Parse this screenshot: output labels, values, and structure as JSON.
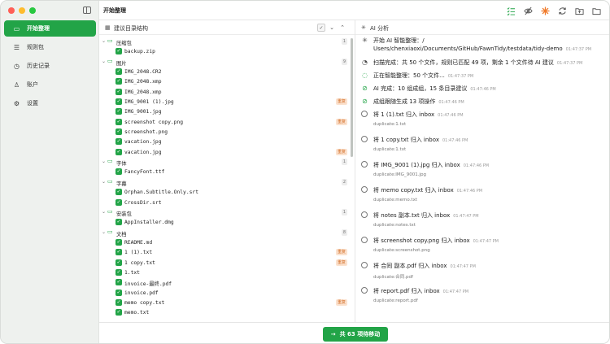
{
  "colors": {
    "accent": "#22a447",
    "tag_bg": "#fbe2cf",
    "tag_fg": "#d2691e",
    "traffic_red": "#ff5f57",
    "traffic_yellow": "#febc2e",
    "traffic_green": "#28c840"
  },
  "header": {
    "title": "开始整理"
  },
  "toolbar_icons": [
    "list-check-icon",
    "eye-off-icon",
    "sparkle-icon",
    "refresh-icon",
    "folder-export-icon",
    "folder-icon"
  ],
  "sidebar": {
    "items": [
      {
        "label": "开始整理",
        "icon": "folder-open-icon",
        "glyph": "▭",
        "active": true
      },
      {
        "label": "规则包",
        "icon": "rules-icon",
        "glyph": "☰"
      },
      {
        "label": "历史记录",
        "icon": "history-icon",
        "glyph": "◷"
      },
      {
        "label": "账户",
        "icon": "user-icon",
        "glyph": "♙"
      },
      {
        "label": "设置",
        "icon": "gear-icon",
        "glyph": "⚙"
      }
    ]
  },
  "structure": {
    "title": "建议目录结构",
    "tree": [
      {
        "type": "folder",
        "name": "压缩包",
        "count": "1"
      },
      {
        "type": "file",
        "name": "backup.zip"
      },
      {
        "type": "folder",
        "name": "图片",
        "count": "9"
      },
      {
        "type": "file",
        "name": "IMG_2048.CR2"
      },
      {
        "type": "file",
        "name": "IMG_2048.xmp"
      },
      {
        "type": "file",
        "name": "IMG_2048.xmp"
      },
      {
        "type": "file",
        "name": "IMG_9001 (1).jpg",
        "tag": "重复"
      },
      {
        "type": "file",
        "name": "IMG_9001.jpg"
      },
      {
        "type": "file",
        "name": "screenshot copy.png",
        "tag": "重复"
      },
      {
        "type": "file",
        "name": "screenshot.png"
      },
      {
        "type": "file",
        "name": "vacation.jpg"
      },
      {
        "type": "file",
        "name": "vacation.jpg",
        "tag": "重复"
      },
      {
        "type": "folder",
        "name": "字体",
        "count": "1"
      },
      {
        "type": "file",
        "name": "FancyFont.ttf"
      },
      {
        "type": "folder",
        "name": "字幕",
        "count": "2"
      },
      {
        "type": "file",
        "name": "Orphan.Subtitle.Only.srt"
      },
      {
        "type": "file",
        "name": "CrossDir.srt"
      },
      {
        "type": "folder",
        "name": "安装包",
        "count": "1"
      },
      {
        "type": "file",
        "name": "AppInstaller.dmg"
      },
      {
        "type": "folder",
        "name": "文档",
        "count": "8"
      },
      {
        "type": "file",
        "name": "README.md"
      },
      {
        "type": "file",
        "name": "1 (1).txt",
        "tag": "重复"
      },
      {
        "type": "file",
        "name": "1 copy.txt",
        "tag": "重复"
      },
      {
        "type": "file",
        "name": "1.txt"
      },
      {
        "type": "file",
        "name": "invoice-最终.pdf"
      },
      {
        "type": "file",
        "name": "invoice.pdf"
      },
      {
        "type": "file",
        "name": "memo copy.txt",
        "tag": "重复"
      },
      {
        "type": "file",
        "name": "memo.txt"
      }
    ]
  },
  "analysis": {
    "title": "AI 分析",
    "log": [
      {
        "status": "sparkle",
        "text": "开始 AI 智能整理：/",
        "time": "",
        "text2": "Users/chenxiaoxi/Documents/GitHub/FawnTidy/testdata/tidy-demo",
        "time2": "01:47:37 PM"
      },
      {
        "status": "refresh",
        "text": "扫描完成：共 50 个文件，规则已匹配 49 项，剩余 1 个文件待 AI 建议",
        "time": "01:47:37 PM"
      },
      {
        "status": "spinner",
        "text": "正在智能整理：50 个文件...",
        "time": "01:47:37 PM"
      },
      {
        "status": "done",
        "text": "AI 完成：10 组成组，15 条目录建议",
        "time": "01:47:46 PM"
      },
      {
        "status": "done",
        "text": "成组跟随生成 13 项操作",
        "time": "01:47:46 PM"
      },
      {
        "status": "pending",
        "text": "将 1 (1).txt 归入 inbox",
        "time": "01:47:46 PM",
        "sub": "duplicate:1.txt"
      },
      {
        "status": "pending",
        "text": "将 1 copy.txt 归入 inbox",
        "time": "01:47:46 PM",
        "sub": "duplicate:1.txt"
      },
      {
        "status": "pending",
        "text": "将 IMG_9001 (1).jpg 归入 inbox",
        "time": "01:47:46 PM",
        "sub": "duplicate:IMG_9001.jpg"
      },
      {
        "status": "pending",
        "text": "将 memo copy.txt 归入 inbox",
        "time": "01:47:46 PM",
        "sub": "duplicate:memo.txt"
      },
      {
        "status": "pending",
        "text": "将 notes 副本.txt 归入 inbox",
        "time": "01:47:47 PM",
        "sub": "duplicate:notes.txt"
      },
      {
        "status": "pending",
        "text": "将 screenshot copy.png 归入 inbox",
        "time": "01:47:47 PM",
        "sub": "duplicate:screenshot.png"
      },
      {
        "status": "pending",
        "text": "将 合同 副本.pdf 归入 inbox",
        "time": "01:47:47 PM",
        "sub": "duplicate:合同.pdf"
      },
      {
        "status": "pending",
        "text": "将 report.pdf 归入 inbox",
        "time": "01:47:47 PM",
        "sub": "duplicate:report.pdf"
      }
    ]
  },
  "footer": {
    "move_label": "共 63 项待移动"
  }
}
